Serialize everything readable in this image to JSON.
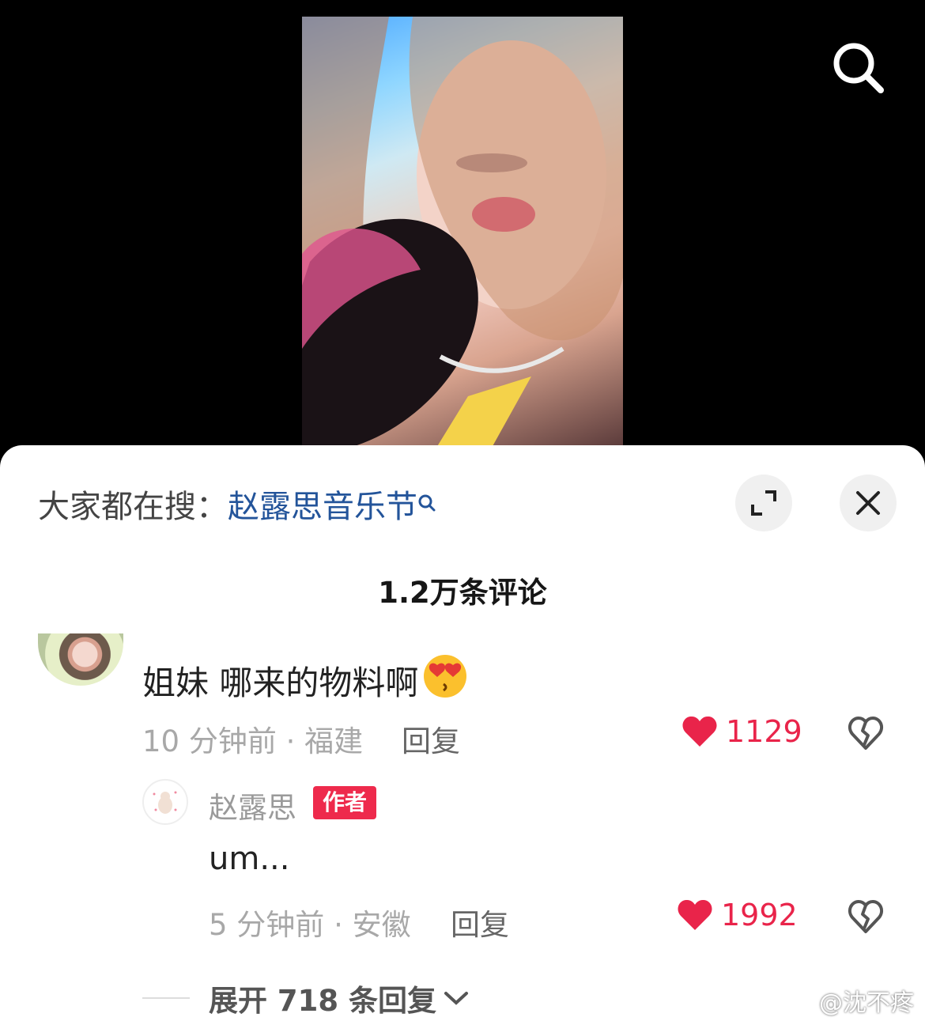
{
  "hot_search": {
    "prefix": "大家都在搜：",
    "query": "赵露思音乐节"
  },
  "comments_count": "1.2万条评论",
  "comment": {
    "text": "姐妹 哪来的物料啊",
    "emoji": "😍",
    "time_location": "10 分钟前 · 福建",
    "reply_label": "回复",
    "likes": "1129"
  },
  "author_reply": {
    "author": "赵露思",
    "badge": "作者",
    "text": "um...",
    "time_location": "5 分钟前 · 安徽",
    "reply_label": "回复",
    "likes": "1992"
  },
  "expand_replies": "展开 718 条回复",
  "watermark": "@沈不疼",
  "colors": {
    "like_red": "#e9244a",
    "link_blue": "#23549a",
    "author_badge": "#ee2a4c"
  },
  "icons": [
    "search-icon",
    "magnifier-small-icon",
    "expand-icon",
    "close-icon",
    "heart-icon",
    "broken-heart-icon",
    "chevron-down-icon",
    "weibo-logo-icon"
  ]
}
